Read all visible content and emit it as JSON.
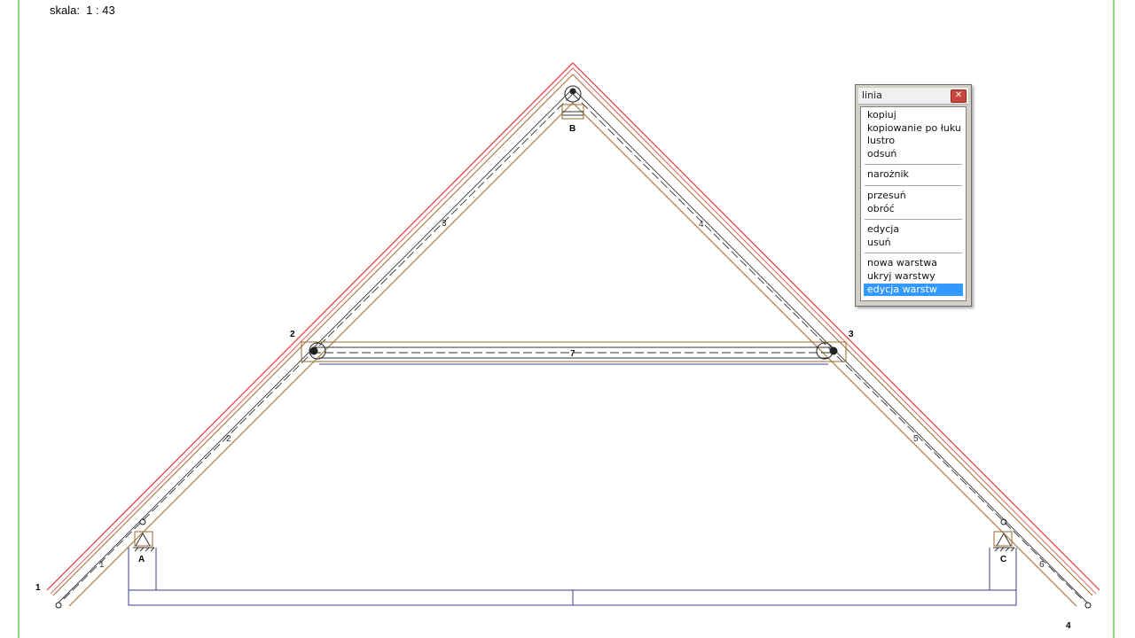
{
  "scale": {
    "text": "skala:  1 : 43"
  },
  "drawing": {
    "node_labels": [
      "1",
      "2",
      "3",
      "4"
    ],
    "member_labels": [
      "1",
      "2",
      "3",
      "4",
      "5",
      "6",
      "7"
    ],
    "support_labels": [
      "A",
      "B",
      "C"
    ],
    "colors": {
      "roof_outer": "#e23838",
      "member_brown": "#9c6a2e",
      "member_dark": "#333333",
      "ceiling_blue": "#3c3c8c",
      "frame_green": "#8fdc7f"
    }
  },
  "context_menu": {
    "title": "linia",
    "close_icon": "close-icon",
    "groups": [
      {
        "items": [
          {
            "label": "kopiuj"
          },
          {
            "label": "kopiowanie po łuku"
          },
          {
            "label": "lustro"
          },
          {
            "label": "odsuń"
          }
        ]
      },
      {
        "items": [
          {
            "label": "narożnik"
          }
        ]
      },
      {
        "items": [
          {
            "label": "przesuń"
          },
          {
            "label": "obróć"
          }
        ]
      },
      {
        "items": [
          {
            "label": "edycja"
          },
          {
            "label": "usuń"
          }
        ]
      },
      {
        "items": [
          {
            "label": "nowa warstwa"
          },
          {
            "label": "ukryj warstwy"
          },
          {
            "label": "edycja warstw",
            "selected": true
          }
        ]
      }
    ]
  }
}
